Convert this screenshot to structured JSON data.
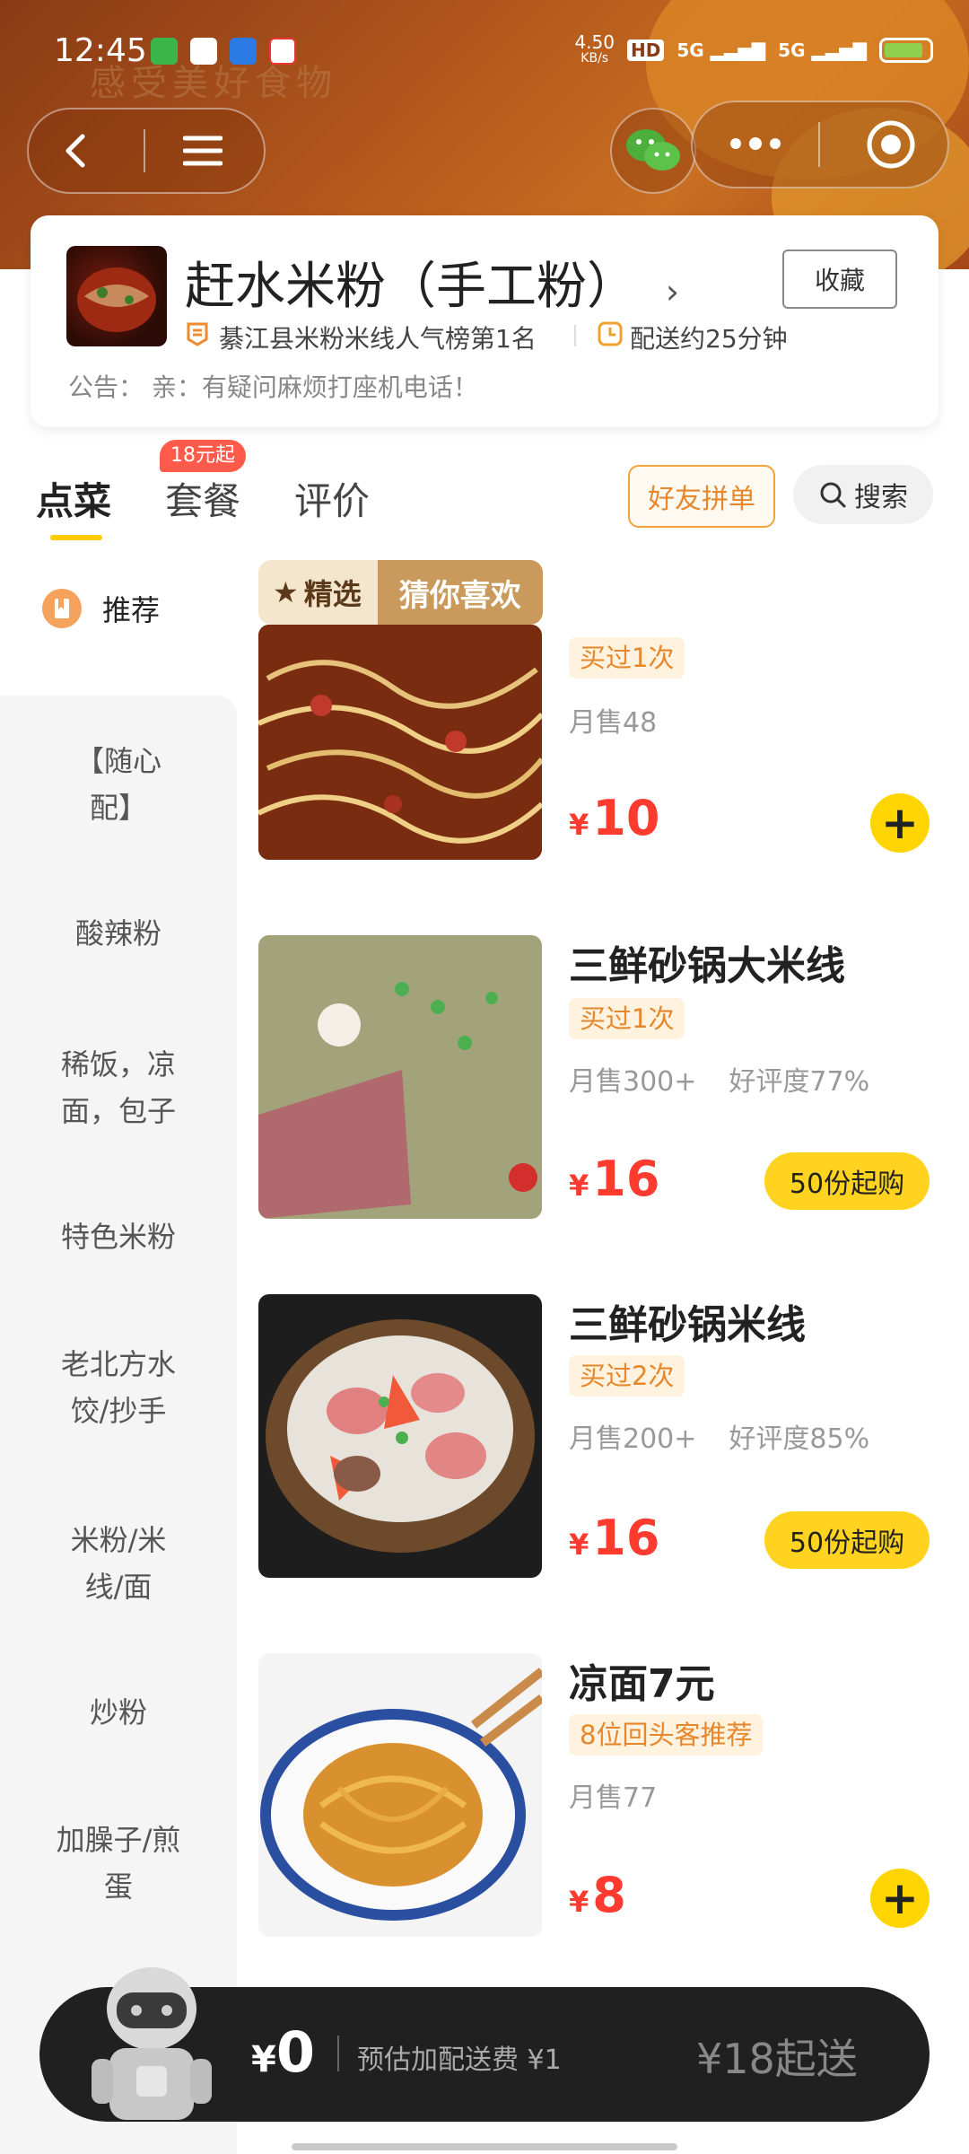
{
  "status_bar": {
    "time": "12:45",
    "net_speed": "4.50",
    "net_unit": "KB/s",
    "hd": "HD",
    "sig1": "5G",
    "sig2": "5G"
  },
  "hero": {
    "deco_text": "感受美好食物"
  },
  "store": {
    "name": "赶水米粉（手工粉）",
    "favorite_label": "收藏",
    "rank": "綦江县米粉米线人气榜第1名",
    "delivery": "配送约25分钟",
    "notice": "公告：  亲：有疑问麻烦打座机电话！"
  },
  "tabs": [
    {
      "label": "点菜"
    },
    {
      "label": "套餐",
      "tag": "18元起"
    },
    {
      "label": "评价"
    }
  ],
  "actions": {
    "group_order": "好友拼单",
    "search": "搜索"
  },
  "sidebar": {
    "recommend": "推荐",
    "items": [
      {
        "line1": "【随心",
        "line2": "配】"
      },
      {
        "line1": "酸辣粉",
        "line2": ""
      },
      {
        "line1": "稀饭，凉",
        "line2": "面，包子"
      },
      {
        "line1": "特色米粉",
        "line2": ""
      },
      {
        "line1": "老北方水",
        "line2": "饺/抄手"
      },
      {
        "line1": "米粉/米",
        "line2": "线/面"
      },
      {
        "line1": "炒粉",
        "line2": ""
      },
      {
        "line1": "加臊子/煎",
        "line2": "蛋"
      }
    ]
  },
  "section": {
    "tag1": "精选",
    "tag2": "猜你喜欢"
  },
  "dishes": [
    {
      "name": "",
      "badge": "买过1次",
      "sales": "月售48",
      "rating": "",
      "currency": "¥",
      "price": "10",
      "action": "+"
    },
    {
      "name": "三鲜砂锅大米线",
      "badge": "买过1次",
      "sales": "月售300+",
      "rating": "好评度77%",
      "currency": "¥",
      "price": "16",
      "action": "50份起购"
    },
    {
      "name": "三鲜砂锅米线",
      "badge": "买过2次",
      "sales": "月售200+",
      "rating": "好评度85%",
      "currency": "¥",
      "price": "16",
      "action": "50份起购"
    },
    {
      "name": "凉面7元",
      "badge": "8位回头客推荐",
      "sales": "月售77",
      "rating": "",
      "currency": "¥",
      "price": "8",
      "action": "+"
    }
  ],
  "cart": {
    "currency": "¥",
    "amount": "0",
    "fee": "预估加配送费 ¥1",
    "min_order": "¥18起送"
  },
  "colors": {
    "accent": "#ffd500",
    "price": "#ff3b30",
    "badge_text": "#e5872a",
    "cart_bg": "#202020"
  }
}
